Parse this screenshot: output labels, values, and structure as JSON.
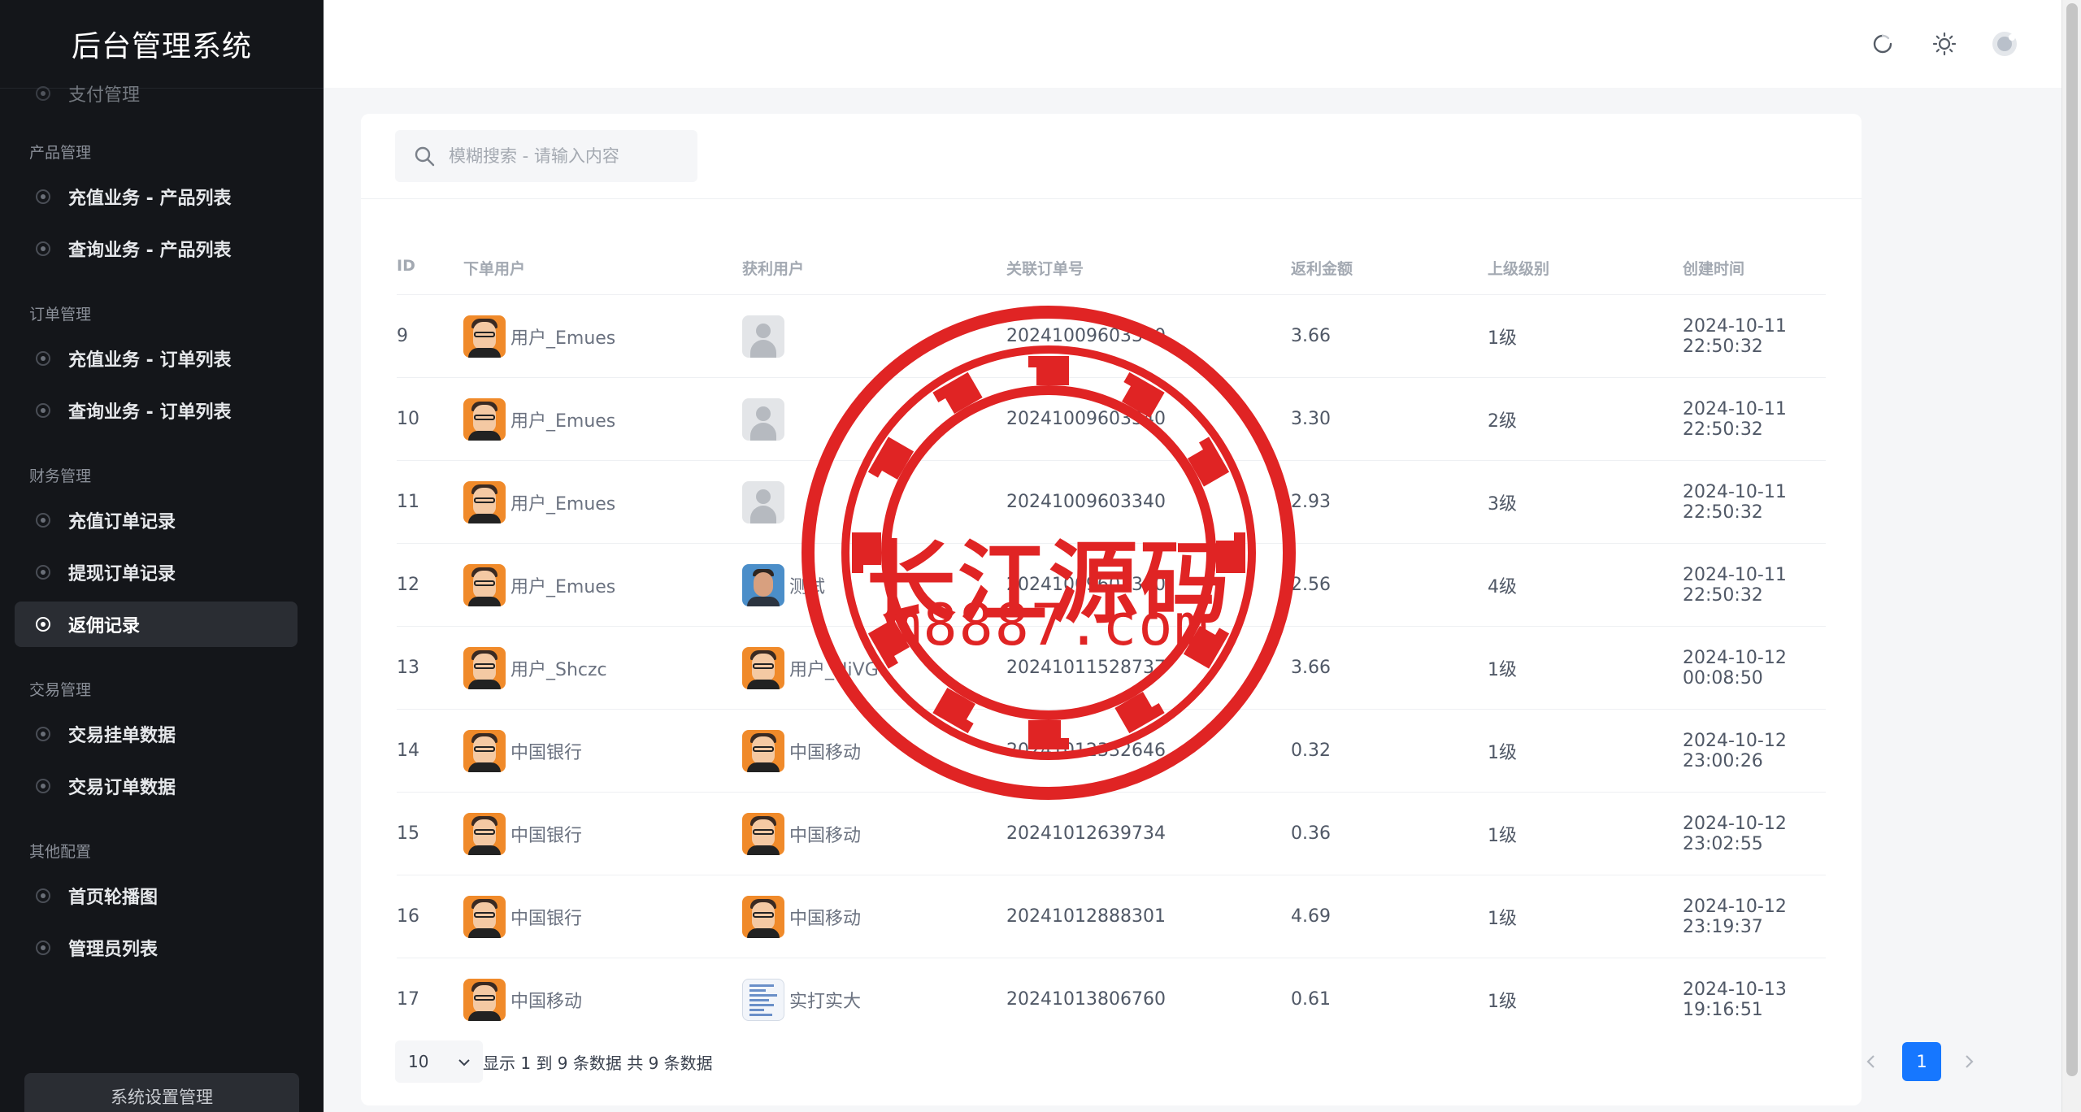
{
  "app": {
    "title": "后台管理系统"
  },
  "sidebar": {
    "cut_item": "支付管理",
    "groups": [
      {
        "title": "产品管理",
        "items": [
          {
            "label": "充值业务 - 产品列表"
          },
          {
            "label": "查询业务 - 产品列表"
          }
        ]
      },
      {
        "title": "订单管理",
        "items": [
          {
            "label": "充值业务 - 订单列表"
          },
          {
            "label": "查询业务 - 订单列表"
          }
        ]
      },
      {
        "title": "财务管理",
        "items": [
          {
            "label": "充值订单记录"
          },
          {
            "label": "提现订单记录"
          },
          {
            "label": "返佣记录",
            "active": true
          }
        ]
      },
      {
        "title": "交易管理",
        "items": [
          {
            "label": "交易挂单数据"
          },
          {
            "label": "交易订单数据"
          }
        ]
      },
      {
        "title": "其他配置",
        "items": [
          {
            "label": "首页轮播图"
          },
          {
            "label": "管理员列表"
          }
        ]
      }
    ],
    "bottom_button": "系统设置管理"
  },
  "header": {
    "icons": [
      "refresh-icon",
      "sun-icon",
      "user-avatar-icon"
    ]
  },
  "search": {
    "placeholder": "模糊搜索 - 请输入内容"
  },
  "table": {
    "columns": [
      "ID",
      "下单用户",
      "获利用户",
      "关联订单号",
      "返利金额",
      "上级级别",
      "创建时间"
    ],
    "rows": [
      {
        "id": "9",
        "buyer": "用户_Emues",
        "buyer_avatar": "orange",
        "earner": "",
        "earner_avatar": "gray",
        "order": "20241009603340",
        "amount": "3.66",
        "level": "1级",
        "time": "2024-10-11 22:50:32"
      },
      {
        "id": "10",
        "buyer": "用户_Emues",
        "buyer_avatar": "orange",
        "earner": "",
        "earner_avatar": "gray",
        "order": "20241009603340",
        "amount": "3.30",
        "level": "2级",
        "time": "2024-10-11 22:50:32"
      },
      {
        "id": "11",
        "buyer": "用户_Emues",
        "buyer_avatar": "orange",
        "earner": "",
        "earner_avatar": "gray",
        "order": "20241009603340",
        "amount": "2.93",
        "level": "3级",
        "time": "2024-10-11 22:50:32"
      },
      {
        "id": "12",
        "buyer": "用户_Emues",
        "buyer_avatar": "orange",
        "earner": "测试",
        "earner_avatar": "photo",
        "order": "20241009603340",
        "amount": "2.56",
        "level": "4级",
        "time": "2024-10-11 22:50:32"
      },
      {
        "id": "13",
        "buyer": "用户_Shczc",
        "buyer_avatar": "orange",
        "earner": "用户_HiVG",
        "earner_avatar": "orange",
        "order": "20241011528737",
        "amount": "3.66",
        "level": "1级",
        "time": "2024-10-12 00:08:50"
      },
      {
        "id": "14",
        "buyer": "中国银行",
        "buyer_avatar": "orange",
        "earner": "中国移动",
        "earner_avatar": "orange",
        "order": "20241012332646",
        "amount": "0.32",
        "level": "1级",
        "time": "2024-10-12 23:00:26"
      },
      {
        "id": "15",
        "buyer": "中国银行",
        "buyer_avatar": "orange",
        "earner": "中国移动",
        "earner_avatar": "orange",
        "order": "20241012639734",
        "amount": "0.36",
        "level": "1级",
        "time": "2024-10-12 23:02:55"
      },
      {
        "id": "16",
        "buyer": "中国银行",
        "buyer_avatar": "orange",
        "earner": "中国移动",
        "earner_avatar": "orange",
        "order": "20241012888301",
        "amount": "4.69",
        "level": "1级",
        "time": "2024-10-12 23:19:37"
      },
      {
        "id": "17",
        "buyer": "中国移动",
        "buyer_avatar": "orange",
        "earner": "实打实大",
        "earner_avatar": "doc",
        "order": "20241013806760",
        "amount": "0.61",
        "level": "1级",
        "time": "2024-10-13 19:16:51"
      }
    ]
  },
  "pagination": {
    "page_size": "10",
    "info": "显示 1 到 9 条数据 共 9 条数据",
    "current_page": "1"
  },
  "watermark": {
    "line1": "长江源码",
    "line2": "m8887.com",
    "color": "#e02424"
  },
  "colors": {
    "sidebar_bg": "#14161a",
    "accent": "#1677ff",
    "watermark": "#e02424"
  }
}
